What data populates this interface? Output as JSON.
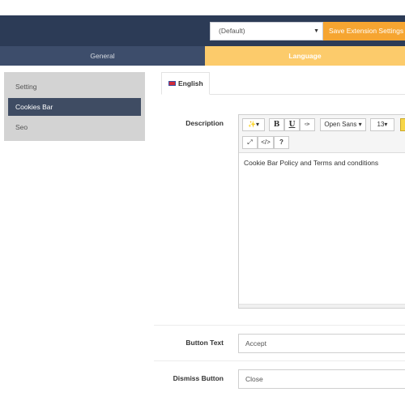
{
  "header": {
    "store_select_value": "(Default)",
    "save_button_label": "Save Extension Settings"
  },
  "tabs": [
    {
      "label": "General",
      "active": false
    },
    {
      "label": "Language",
      "active": true
    }
  ],
  "sidebar": {
    "items": [
      {
        "label": "Setting",
        "active": false
      },
      {
        "label": "Cookies Bar",
        "active": true
      },
      {
        "label": "Seo",
        "active": false
      }
    ]
  },
  "language_tab": {
    "label": "English"
  },
  "form": {
    "description_label": "Description",
    "editor": {
      "toolbar": {
        "magic_icon": "✨▾",
        "bold": "B",
        "underline": "U",
        "eraser_icon": "✑",
        "font_family": "Open Sans ▾",
        "font_size": "13▾",
        "fullscreen_icon": "⤢",
        "code_icon": "</>",
        "help_icon": "?"
      },
      "content": "Cookie Bar Policy and Terms and conditions"
    },
    "button_text_label": "Button Text",
    "button_text_value": "Accept",
    "dismiss_button_label": "Dismiss Button",
    "dismiss_button_value": "Close"
  },
  "colors": {
    "topbar": "#2c3b56",
    "save_button": "#f6a531",
    "tab_general": "#3d4d6b",
    "tab_language": "#fccb6b",
    "sidebar_bg": "#d3d3d3",
    "sidebar_active": "#3f4c63"
  }
}
